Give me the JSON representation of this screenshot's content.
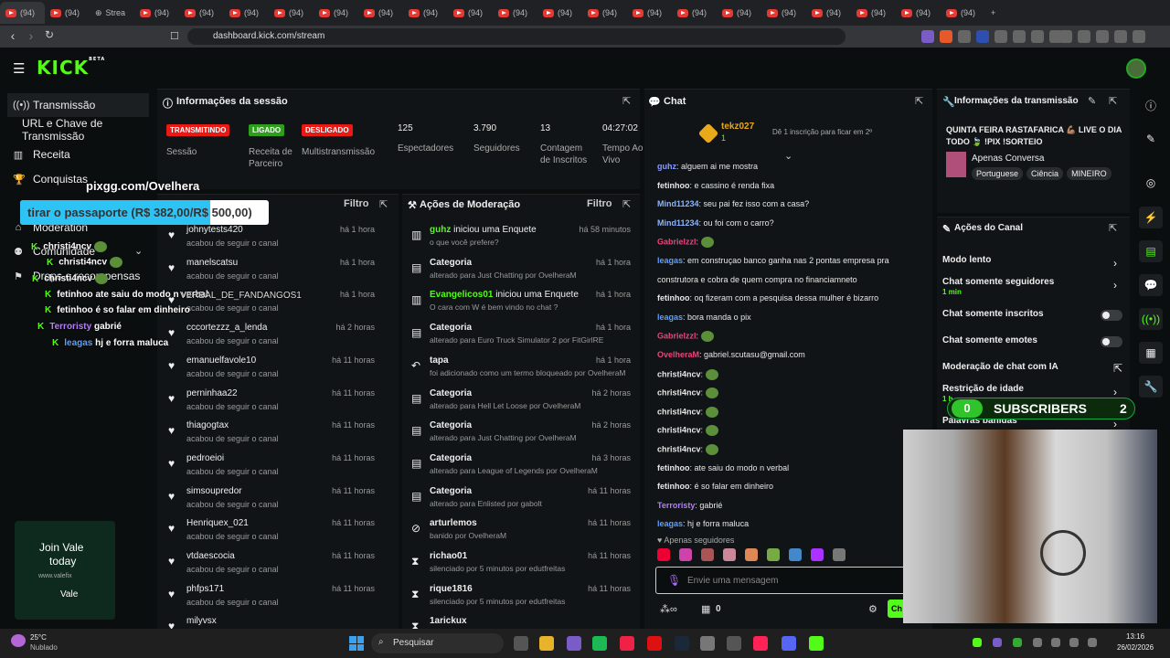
{
  "browser": {
    "tabs": [
      "(94)",
      "(94)",
      "Strea",
      "(94)",
      "(94)",
      "(94)",
      "(94)",
      "(94)",
      "(94)",
      "(94)",
      "(94)",
      "(94)",
      "(94)",
      "(94)",
      "(94)",
      "(94)",
      "(94)",
      "(94)",
      "(94)",
      "(94)",
      "(94)",
      "(94)"
    ],
    "url": "dashboard.kick.com/stream"
  },
  "sidebar": {
    "items": [
      {
        "label": "Transmissão",
        "icon": "broadcast-icon"
      },
      {
        "label": "URL e Chave de Transmissão",
        "icon": "key-icon"
      },
      {
        "label": "Receita",
        "icon": "revenue-icon"
      },
      {
        "label": "Conquistas",
        "icon": "trophy-icon"
      },
      {
        "label": "Moderation",
        "icon": "shield-icon"
      },
      {
        "label": "Comunidade",
        "icon": "community-icon"
      },
      {
        "label": "Drops e recompensas",
        "icon": "gift-icon"
      }
    ]
  },
  "overlays": {
    "pix": "pixgg.com/Ovelhera",
    "goal": "tirar o passaporte (R$ 382,00/R$ 500,00)",
    "goal_fraction": 0.764,
    "chat_overlay": [
      {
        "user": "christi4ncv",
        "msg": ""
      },
      {
        "user": "christi4ncv",
        "msg": ""
      },
      {
        "user": "christi4ncv",
        "msg": ""
      },
      {
        "user": "fetinhoo",
        "msg": "ate saiu do modo n verbal"
      },
      {
        "user": "fetinhoo",
        "msg": "é so falar em dinheiro"
      },
      {
        "user": "Terroristy",
        "msg": "gabrié"
      },
      {
        "user": "leagas",
        "msg": "hj e forra maluca"
      }
    ],
    "obscured_text": "VERBAL_DE_FANDANGOS1",
    "subscribers": {
      "count_left": "0",
      "label": "SUBSCRIBERS",
      "count_right": "2"
    },
    "join": {
      "line1": "Join Vale",
      "line2": "today",
      "line3": "www.valefix",
      "brand": "Vale"
    }
  },
  "session": {
    "title": "Informações da sessão",
    "badges": [
      {
        "label": "TRANSMITINDO",
        "color": "#e91916",
        "caption": "Sessão"
      },
      {
        "label": "LIGADO",
        "color": "#2f9e1c",
        "caption": "Receita de Parceiro"
      },
      {
        "label": "DESLIGADO",
        "color": "#e91916",
        "caption": "Multistransmissão"
      }
    ],
    "stats": [
      {
        "value": "125",
        "label": "Espectadores"
      },
      {
        "value": "3.790",
        "label": "Seguidores"
      },
      {
        "value": "13",
        "label": "Contagem de Inscritos"
      },
      {
        "value": "04:27:02",
        "label": "Tempo Ao Vivo"
      }
    ]
  },
  "followers": {
    "filter": "Filtro",
    "rows": [
      {
        "name": "johnytests420",
        "sub": "acabou de seguir o canal",
        "time": "há 1 hora"
      },
      {
        "name": "manelscatsu",
        "sub": "acabou de seguir o canal",
        "time": "há 1 hora"
      },
      {
        "name": "",
        "sub": "acabou de seguir o canal",
        "time": "há 1 hora"
      },
      {
        "name": "cccortezzz_a_lenda",
        "sub": "acabou de seguir o canal",
        "time": "há 2 horas"
      },
      {
        "name": "emanuelfavole10",
        "sub": "acabou de seguir o canal",
        "time": "há 11 horas"
      },
      {
        "name": "perninhaa22",
        "sub": "acabou de seguir o canal",
        "time": "há 11 horas"
      },
      {
        "name": "thiagogtax",
        "sub": "acabou de seguir o canal",
        "time": "há 11 horas"
      },
      {
        "name": "pedroeioi",
        "sub": "acabou de seguir o canal",
        "time": "há 11 horas"
      },
      {
        "name": "simsoupredor",
        "sub": "acabou de seguir o canal",
        "time": "há 11 horas"
      },
      {
        "name": "Henriquex_021",
        "sub": "acabou de seguir o canal",
        "time": "há 11 horas"
      },
      {
        "name": "vtdaescocia",
        "sub": "acabou de seguir o canal",
        "time": "há 11 horas"
      },
      {
        "name": "phfps171",
        "sub": "acabou de seguir o canal",
        "time": "há 11 horas"
      },
      {
        "name": "milyvsx",
        "sub": "",
        "time": ""
      }
    ]
  },
  "moderation": {
    "title": "Ações de Moderação",
    "filter": "Filtro",
    "rows": [
      {
        "icon": "poll-icon",
        "user": "guhz",
        "action": " iniciou uma Enquete",
        "sub": "o que você prefere?",
        "time": "há 58 minutos"
      },
      {
        "icon": "category-icon",
        "user": "",
        "action": "Categoria",
        "sub": "alterado para Just Chatting por OvelheraM",
        "time": "há 1 hora"
      },
      {
        "icon": "poll-icon",
        "user": "Evangelicos01",
        "action": " iniciou uma Enquete",
        "sub": "O cara com W é bem vindo no chat ?",
        "time": "há 1 hora"
      },
      {
        "icon": "category-icon",
        "user": "",
        "action": "Categoria",
        "sub": "alterado para Euro Truck Simulator 2 por FitGirlRE",
        "time": "há 1 hora"
      },
      {
        "icon": "undo-icon",
        "user": "",
        "action": "tapa",
        "sub": "foi adicionado como um termo bloqueado por OvelheraM",
        "time": "há 1 hora"
      },
      {
        "icon": "category-icon",
        "user": "",
        "action": "Categoria",
        "sub": "alterado para Hell Let Loose por OvelheraM",
        "time": "há 2 horas"
      },
      {
        "icon": "category-icon",
        "user": "",
        "action": "Categoria",
        "sub": "alterado para Just Chatting por OvelheraM",
        "time": "há 2 horas"
      },
      {
        "icon": "category-icon",
        "user": "",
        "action": "Categoria",
        "sub": "alterado para League of Legends por OvelheraM",
        "time": "há 3 horas"
      },
      {
        "icon": "category-icon",
        "user": "",
        "action": "Categoria",
        "sub": "alterado para Enlisted por gabolt",
        "time": "há 11 horas"
      },
      {
        "icon": "ban-icon",
        "user": "",
        "action": "arturlemos",
        "sub": "banido por OvelheraM",
        "time": "há 11 horas"
      },
      {
        "icon": "timeout-icon",
        "user": "",
        "action": "richao01",
        "sub": "silenciado por 5 minutos por edutfreitas",
        "time": "há 11 horas"
      },
      {
        "icon": "timeout-icon",
        "user": "",
        "action": "rique1816",
        "sub": "silenciado por 5 minutos por edutfreitas",
        "time": "há 11 horas"
      },
      {
        "icon": "timeout-icon",
        "user": "",
        "action": "1arickux",
        "sub": "",
        "time": ""
      }
    ]
  },
  "chat": {
    "title": "Chat",
    "pinned_user": "tekz027",
    "pinned_count": "1",
    "pinned_note": "Dê 1 inscrição para ficar em 2º",
    "messages": [
      {
        "user": "guhz",
        "color": "#8a9bff",
        "text": "alguem ai me mostra"
      },
      {
        "user": "fetinhoo",
        "color": "#e6e6e6",
        "text": "e cassino é renda fixa"
      },
      {
        "user": "Mind11234",
        "color": "#8ab4ff",
        "text": "seu pai fez isso com a casa?"
      },
      {
        "user": "Mind11234",
        "color": "#8ab4ff",
        "text": "ou foi com o carro?"
      },
      {
        "user": "Gabrielzzl",
        "color": "#e8457a",
        "text": ""
      },
      {
        "user": "leagas",
        "color": "#5aa0ff",
        "text": "em construçao banco ganha nas 2 pontas empresa pra"
      },
      {
        "user": "",
        "color": "#e6e6e6",
        "text": "construtora e cobra de quem compra no financiamneto"
      },
      {
        "user": "fetinhoo",
        "color": "#e6e6e6",
        "text": "oq fizeram com a pesquisa dessa mulher é bizarro"
      },
      {
        "user": "leagas",
        "color": "#5aa0ff",
        "text": "bora manda o pix"
      },
      {
        "user": "Gabrielzzl",
        "color": "#e8457a",
        "text": ""
      },
      {
        "user": "OvelheraM",
        "color": "#e8457a",
        "text": "gabriel.scutasu@gmail.com"
      },
      {
        "user": "christi4ncv",
        "color": "#e6e6e6",
        "text": ""
      },
      {
        "user": "christi4ncv",
        "color": "#e6e6e6",
        "text": ""
      },
      {
        "user": "christi4ncv",
        "color": "#e6e6e6",
        "text": ""
      },
      {
        "user": "christi4ncv",
        "color": "#e6e6e6",
        "text": ""
      },
      {
        "user": "christi4ncv",
        "color": "#e6e6e6",
        "text": ""
      },
      {
        "user": "fetinhoo",
        "color": "#e6e6e6",
        "text": "ate saiu do modo n verbal"
      },
      {
        "user": "fetinhoo",
        "color": "#e6e6e6",
        "text": "é so falar em dinheiro"
      },
      {
        "user": "Terroristy",
        "color": "#b77cff",
        "text": "gabrié"
      },
      {
        "user": "leagas",
        "color": "#5aa0ff",
        "text": "hj e forra maluca"
      }
    ],
    "mode": "Apenas seguidores",
    "placeholder": "Envie uma mensagem",
    "count": "0",
    "send": "Ch"
  },
  "stream_info": {
    "title": "Informações da transmissão",
    "stream_title": "QUINTA FEIRA RASTAFARICA 💪🏽 LIVE O DIA TODO 🍃 !PIX !SORTEIO",
    "category": "Apenas Conversa",
    "tags": [
      "Portuguese",
      "Ciência",
      "MINEIRO"
    ]
  },
  "channel": {
    "title": "Ações do Canal",
    "options": [
      {
        "label": "Modo lento",
        "sub": "",
        "control": "chevron"
      },
      {
        "label": "Chat somente seguidores",
        "sub": "1 min",
        "control": "chevron"
      },
      {
        "label": "Chat somente inscritos",
        "sub": "",
        "control": "toggle"
      },
      {
        "label": "Chat somente emotes",
        "sub": "",
        "control": "toggle"
      },
      {
        "label": "Moderação de chat com IA",
        "sub": "",
        "control": "link"
      },
      {
        "label": "Restrição de idade",
        "sub": "1 h",
        "control": "chevron"
      },
      {
        "label": "Palavras banidas",
        "sub": "",
        "control": "chevron"
      }
    ]
  },
  "taskbar": {
    "weather_temp": "25°C",
    "weather_desc": "Nublado",
    "search": "Pesquisar",
    "time": "13:16",
    "date": "26/02/2026"
  }
}
